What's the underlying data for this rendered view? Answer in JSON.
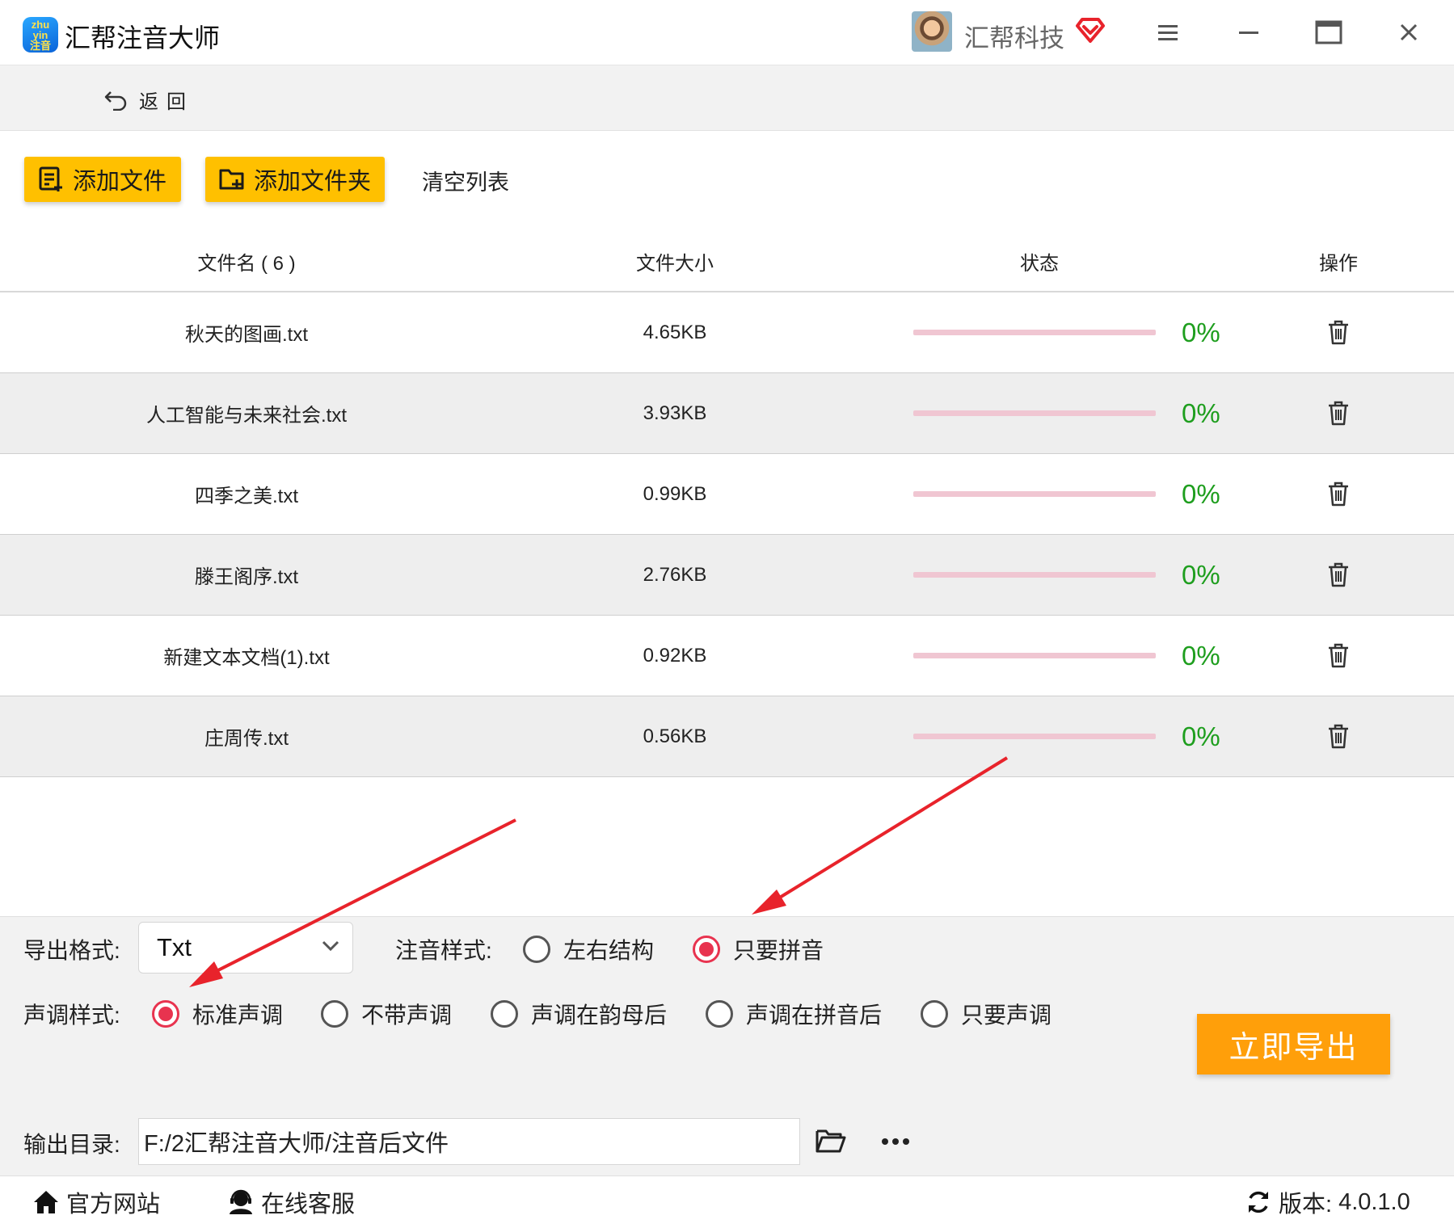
{
  "app": {
    "logo_text": "zhu yin 注音",
    "title": "汇帮注音大师",
    "company": "汇帮科技"
  },
  "nav": {
    "back_label": "返回"
  },
  "toolbar": {
    "add_file": "添加文件",
    "add_folder": "添加文件夹",
    "clear_list": "清空列表"
  },
  "table": {
    "columns": {
      "name": "文件名 ( 6 )",
      "size": "文件大小",
      "status": "状态",
      "action": "操作"
    },
    "rows": [
      {
        "name": "秋天的图画.txt",
        "size": "4.65KB",
        "progress": "0%"
      },
      {
        "name": "人工智能与未来社会.txt",
        "size": "3.93KB",
        "progress": "0%"
      },
      {
        "name": "四季之美.txt",
        "size": "0.99KB",
        "progress": "0%"
      },
      {
        "name": "滕王阁序.txt",
        "size": "2.76KB",
        "progress": "0%"
      },
      {
        "name": "新建文本文档(1).txt",
        "size": "0.92KB",
        "progress": "0%"
      },
      {
        "name": "庄周传.txt",
        "size": "0.56KB",
        "progress": "0%"
      }
    ]
  },
  "settings": {
    "format_label": "导出格式:",
    "format_value": "Txt",
    "annotation_label": "注音样式:",
    "annotation_options": [
      {
        "label": "左右结构",
        "checked": false
      },
      {
        "label": "只要拼音",
        "checked": true
      }
    ],
    "tone_label": "声调样式:",
    "tone_options": [
      {
        "label": "标准声调",
        "checked": true
      },
      {
        "label": "不带声调",
        "checked": false
      },
      {
        "label": "声调在韵母后",
        "checked": false
      },
      {
        "label": "声调在拼音后",
        "checked": false
      },
      {
        "label": "只要声调",
        "checked": false
      }
    ],
    "export_button": "立即导出",
    "output_label": "输出目录:",
    "output_path": "F:/2汇帮注音大师/注音后文件"
  },
  "footer": {
    "website": "官方网站",
    "support": "在线客服",
    "version_label": "版本:",
    "version_value": "4.0.1.0"
  },
  "colors": {
    "accent_yellow": "#ffc000",
    "export_orange": "#ff9f0a",
    "radio_checked": "#e8334f",
    "progress_green": "#1e9e1e",
    "progress_track": "#f0c6d2",
    "annotation_arrow": "#e8232b"
  }
}
